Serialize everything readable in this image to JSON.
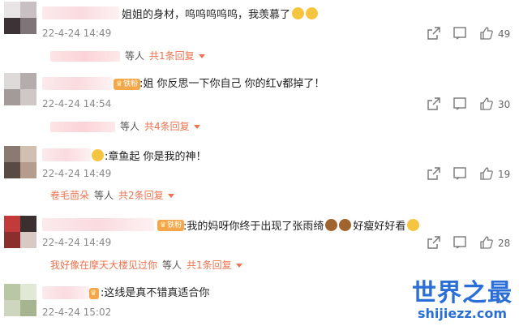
{
  "comments": [
    {
      "text": "姐姐的身材，呜呜呜呜呜，我羡慕了",
      "time": "22-4-24 14:49",
      "likes": "49",
      "reply_prefix": "",
      "reply_mid": "等人",
      "reply_link": "共1条回复"
    },
    {
      "badge": "铁粉",
      "text": ":姐 你反思一下你自己 你的红v都掉了！",
      "time": "22-4-24 14:54",
      "likes": "30",
      "reply_prefix": "",
      "reply_mid": "等人",
      "reply_link": "共4条回复"
    },
    {
      "text": ":章鱼起 你是我的神！",
      "time": "22-4-24 14:49",
      "likes": "19",
      "reply_prefix": "卷毛茴朵",
      "reply_mid": "等人",
      "reply_link": "共2条回复"
    },
    {
      "badge": "铁粉",
      "text": ":我的妈呀你终于出现了张雨绮",
      "text_tail": "好瘦好好看",
      "time": "22-4-24 14:49",
      "likes": "28",
      "reply_prefix": "我好像在摩天大楼见过你",
      "reply_mid": "等人",
      "reply_link": "共1条回复"
    },
    {
      "text": ":这线是真不错真适合你",
      "time": "22-4-24 15:02",
      "likes": ""
    }
  ],
  "icons": {
    "share": "share-icon",
    "comment": "comment-icon",
    "like": "thumbs-up-icon"
  },
  "watermark": {
    "title": "世界之最",
    "url": "shijiezz.com"
  },
  "colors": {
    "link": "#eb7350",
    "badge": "#f3a64a",
    "watermark": "#2b6fd6"
  }
}
